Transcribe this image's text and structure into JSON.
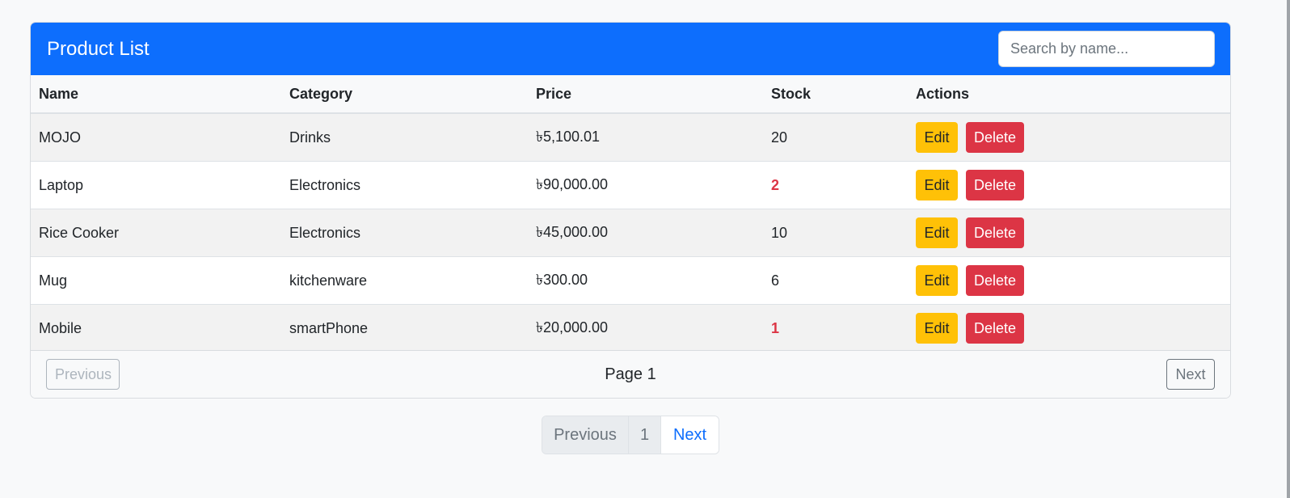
{
  "header": {
    "title": "Product List",
    "search_placeholder": "Search by name..."
  },
  "table": {
    "columns": [
      "Name",
      "Category",
      "Price",
      "Stock",
      "Actions"
    ],
    "rows": [
      {
        "name": "MOJO",
        "category": "Drinks",
        "price": "৳5,100.01",
        "stock": "20",
        "low_stock": false
      },
      {
        "name": "Laptop",
        "category": "Electronics",
        "price": "৳90,000.00",
        "stock": "2",
        "low_stock": true
      },
      {
        "name": "Rice Cooker",
        "category": "Electronics",
        "price": "৳45,000.00",
        "stock": "10",
        "low_stock": false
      },
      {
        "name": "Mug",
        "category": "kitchenware",
        "price": "৳300.00",
        "stock": "6",
        "low_stock": false
      },
      {
        "name": "Mobile",
        "category": "smartPhone",
        "price": "৳20,000.00",
        "stock": "1",
        "low_stock": true
      }
    ],
    "edit_label": "Edit",
    "delete_label": "Delete"
  },
  "card_footer": {
    "previous_label": "Previous",
    "page_label": "Page 1",
    "next_label": "Next"
  },
  "pagination": {
    "previous_label": "Previous",
    "current_page": "1",
    "next_label": "Next"
  },
  "colors": {
    "primary": "#0d6efd",
    "warning": "#ffc107",
    "danger": "#dc3545"
  }
}
